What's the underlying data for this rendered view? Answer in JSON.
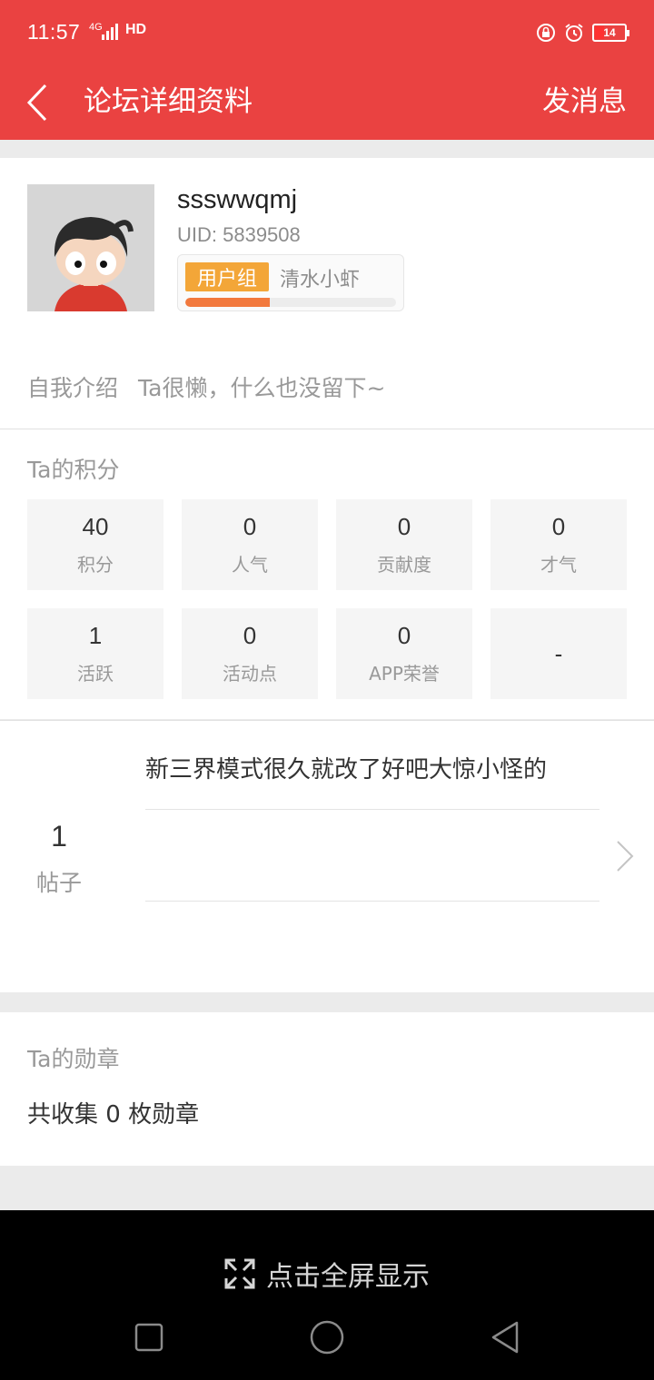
{
  "status_bar": {
    "time": "11:57",
    "network": "4G",
    "hd": "HD",
    "battery": "14"
  },
  "header": {
    "title": "论坛详细资料",
    "action_label": "发消息",
    "background": "#ea4241"
  },
  "profile": {
    "username": "ssswwqmj",
    "uid": "UID: 5839508",
    "group_badge": "用户组",
    "group_name": "清水小虾",
    "group_progress": 0.4,
    "intro_label": "自我介绍",
    "intro_text": "Ta很懒，什么也没留下~"
  },
  "points": {
    "title": "Ta的积分",
    "stats": [
      {
        "value": "40",
        "label": "积分"
      },
      {
        "value": "0",
        "label": "人气"
      },
      {
        "value": "0",
        "label": "贡献度"
      },
      {
        "value": "0",
        "label": "才气"
      },
      {
        "value": "1",
        "label": "活跃"
      },
      {
        "value": "0",
        "label": "活动点"
      },
      {
        "value": "0",
        "label": "APP荣誉"
      },
      {
        "value": "-",
        "label": ""
      }
    ]
  },
  "posts": {
    "count": "1",
    "label": "帖子",
    "latest_title": "新三界模式很久就改了好吧大惊小怪的"
  },
  "medals": {
    "title": "Ta的勋章",
    "summary": "共收集 0 枚勋章"
  },
  "bottom": {
    "fullscreen_label": "点击全屏显示"
  }
}
